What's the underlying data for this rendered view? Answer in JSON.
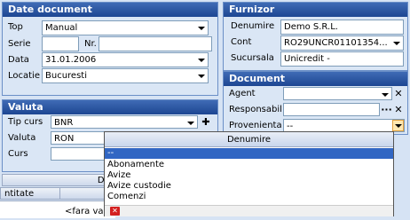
{
  "date_document": {
    "title": "Date document",
    "top": {
      "label": "Top",
      "value": "Manual"
    },
    "serie": {
      "label": "Serie",
      "value": ""
    },
    "nr": {
      "label": "Nr.",
      "value": ""
    },
    "data": {
      "label": "Data",
      "value": "31.01.2006"
    },
    "locatie": {
      "label": "Locatie",
      "value": "Bucuresti"
    }
  },
  "furnizor": {
    "title": "Furnizor",
    "denumire": {
      "label": "Denumire",
      "value": "Demo S.R.L."
    },
    "cont": {
      "label": "Cont",
      "value": "RO29UNCR01101354..."
    },
    "sucursala": {
      "label": "Sucursala",
      "value": "Unicredit -"
    }
  },
  "valuta": {
    "title": "Valuta",
    "tip_curs": {
      "label": "Tip curs",
      "value": "BNR"
    },
    "valuta": {
      "label": "Valuta",
      "value": "RON"
    },
    "curs": {
      "label": "Curs",
      "value": ""
    }
  },
  "document": {
    "title": "Document",
    "agent": {
      "label": "Agent",
      "value": ""
    },
    "responsabil": {
      "label": "Responsabil",
      "value": ""
    },
    "provenienta": {
      "label": "Provenienta",
      "value": "--"
    }
  },
  "dropdown": {
    "header": "Denumire",
    "items": [
      "--",
      "Abonamente",
      "Avize",
      "Avize custodie",
      "Comenzi"
    ]
  },
  "grid": {
    "tab_label": "Date s",
    "col_cantitate": "ntitate",
    "cell_value": "<fara va"
  }
}
